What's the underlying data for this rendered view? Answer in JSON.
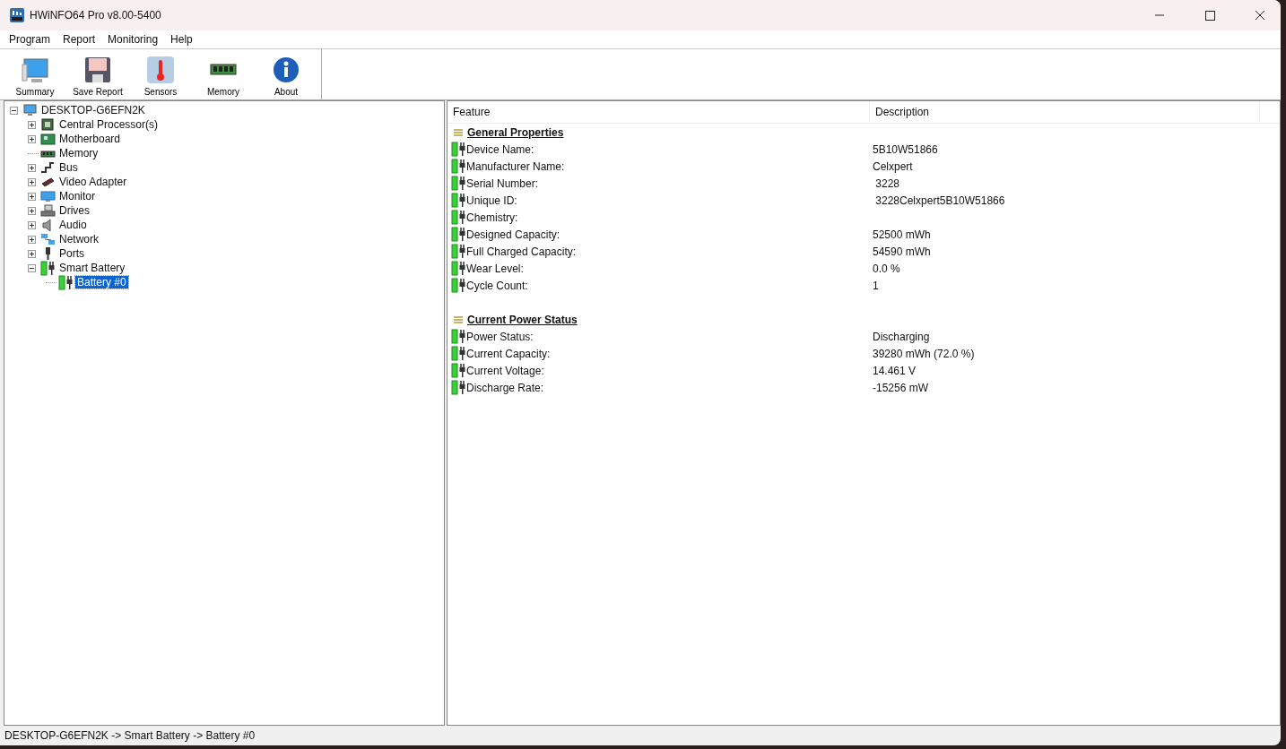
{
  "window": {
    "title": "HWiNFO64 Pro v8.00-5400"
  },
  "menu": [
    "Program",
    "Report",
    "Monitoring",
    "Help"
  ],
  "toolbar": [
    {
      "kind": "summary",
      "label": "Summary"
    },
    {
      "kind": "save",
      "label": "Save Report"
    },
    {
      "kind": "sensors",
      "label": "Sensors"
    },
    {
      "kind": "memory",
      "label": "Memory"
    },
    {
      "kind": "about",
      "label": "About"
    }
  ],
  "tree": [
    {
      "kind": "computer",
      "label": "DESKTOP-G6EFN2K",
      "expanded": true,
      "selected": false,
      "children": [
        {
          "kind": "cpu",
          "label": "Central Processor(s)",
          "expanded": false,
          "selected": false
        },
        {
          "kind": "motherboard",
          "label": "Motherboard",
          "expanded": false,
          "selected": false
        },
        {
          "kind": "memory",
          "label": "Memory",
          "selected": false
        },
        {
          "kind": "bus",
          "label": "Bus",
          "expanded": false,
          "selected": false
        },
        {
          "kind": "gpu",
          "label": "Video Adapter",
          "expanded": false,
          "selected": false
        },
        {
          "kind": "monitor",
          "label": "Monitor",
          "expanded": false,
          "selected": false
        },
        {
          "kind": "drives",
          "label": "Drives",
          "expanded": false,
          "selected": false
        },
        {
          "kind": "audio",
          "label": "Audio",
          "expanded": false,
          "selected": false
        },
        {
          "kind": "network",
          "label": "Network",
          "expanded": false,
          "selected": false
        },
        {
          "kind": "ports",
          "label": "Ports",
          "expanded": false,
          "selected": false
        },
        {
          "kind": "battery",
          "label": "Smart Battery",
          "expanded": true,
          "selected": false,
          "children": [
            {
              "kind": "battery",
              "label": "Battery #0",
              "selected": true
            }
          ]
        }
      ]
    }
  ],
  "table": {
    "columns": [
      "Feature",
      "Description"
    ],
    "rows": [
      {
        "kind": "section",
        "feature": "General Properties"
      },
      {
        "kind": "property",
        "feature": "Device Name:",
        "description": "5B10W51866"
      },
      {
        "kind": "property",
        "feature": "Manufacturer Name:",
        "description": "Celxpert"
      },
      {
        "kind": "property",
        "feature": "Serial Number:",
        "description": " 3228"
      },
      {
        "kind": "property",
        "feature": "Unique ID:",
        "description": " 3228Celxpert5B10W51866"
      },
      {
        "kind": "property",
        "feature": "Chemistry:"
      },
      {
        "kind": "property",
        "feature": "Designed Capacity:",
        "description": "52500 mWh"
      },
      {
        "kind": "property",
        "feature": "Full Charged Capacity:",
        "description": "54590 mWh"
      },
      {
        "kind": "property",
        "feature": "Wear Level:",
        "description": "0.0 %"
      },
      {
        "kind": "property",
        "feature": "Cycle Count:",
        "description": "1"
      },
      {
        "kind": "section",
        "feature": "Current Power Status"
      },
      {
        "kind": "property",
        "feature": "Power Status:",
        "description": "Discharging"
      },
      {
        "kind": "property",
        "feature": "Current Capacity:",
        "description": "39280 mWh (72.0 %)"
      },
      {
        "kind": "property",
        "feature": "Current Voltage:",
        "description": "14.461 V"
      },
      {
        "kind": "property",
        "feature": "Discharge Rate:",
        "description": "-15256 mW"
      }
    ]
  },
  "status_bar": "DESKTOP-G6EFN2K -> Smart Battery -> Battery #0"
}
